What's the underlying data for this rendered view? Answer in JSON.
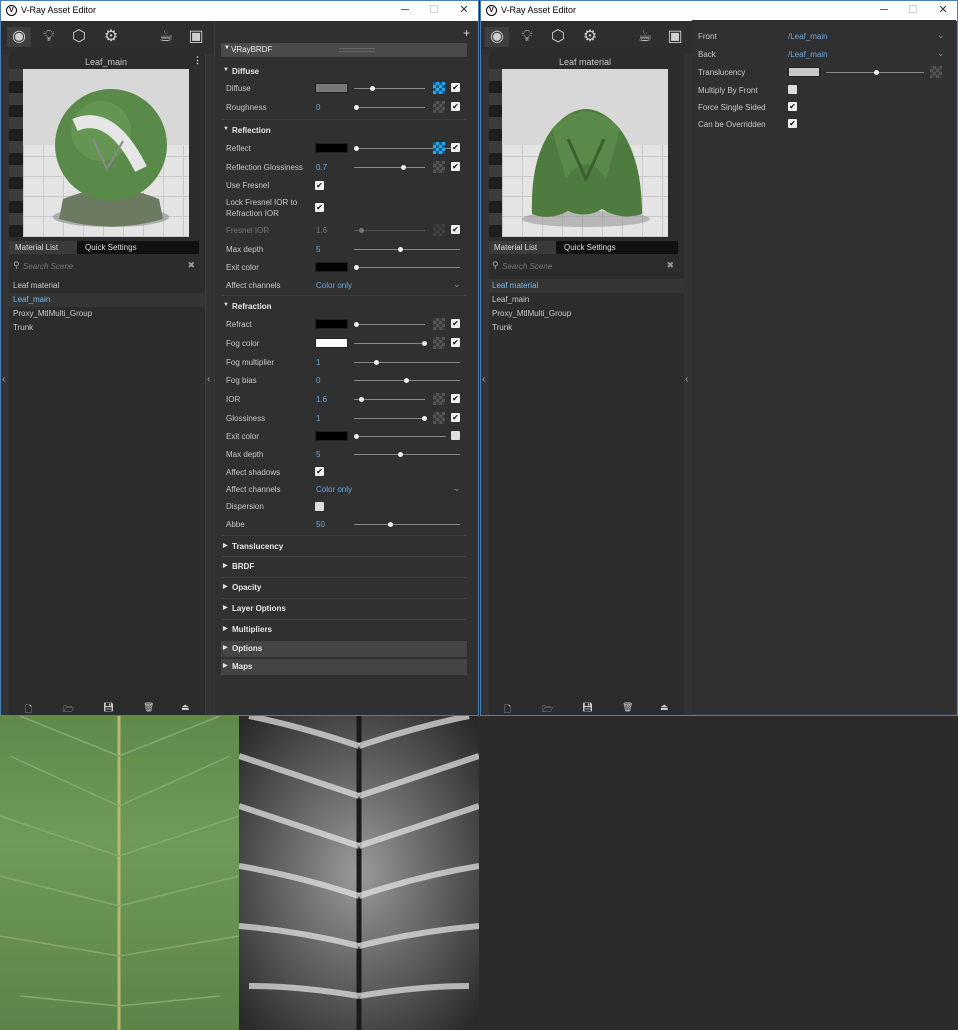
{
  "windowA": {
    "title": "V-Ray Asset Editor",
    "preview_title": "Leaf_main",
    "tabs": [
      "Material List",
      "Quick Settings"
    ],
    "search_placeholder": "Search Scene",
    "materials": [
      "Leaf material",
      "Leaf_main",
      "Proxy_MtlMulti_Group",
      "Trunk"
    ],
    "selected_material": "Leaf_main"
  },
  "windowB": {
    "title": "V-Ray Asset Editor",
    "preview_title": "Leaf material",
    "tabs": [
      "Material List",
      "Quick Settings"
    ],
    "search_placeholder": "Search Scene",
    "materials": [
      "Leaf material",
      "Leaf_main",
      "Proxy_MtlMulti_Group",
      "Trunk"
    ],
    "selected_material": "Leaf material"
  },
  "brdf": {
    "title": "VRayBRDF",
    "diffuse": {
      "header": "Diffuse",
      "diffuse_label": "Diffuse",
      "roughness_label": "Roughness",
      "roughness_value": "0"
    },
    "reflection": {
      "header": "Reflection",
      "reflect_label": "Reflect",
      "gloss_label": "Reflection Glossiness",
      "gloss_value": "0.7",
      "fresnel_label": "Use Fresnel",
      "lock_label_1": "Lock Fresnel IOR to",
      "lock_label_2": "Refraction IOR",
      "fresnel_ior_label": "Fresnel IOR",
      "fresnel_ior_value": "1.6",
      "maxdepth_label": "Max depth",
      "maxdepth_value": "5",
      "exit_label": "Exit color",
      "affect_label": "Affect channels",
      "affect_value": "Color only"
    },
    "refraction": {
      "header": "Refraction",
      "refract_label": "Refract",
      "fog_label": "Fog color",
      "fogmult_label": "Fog multiplier",
      "fogmult_value": "1",
      "fogbias_label": "Fog bias",
      "fogbias_value": "0",
      "ior_label": "IOR",
      "ior_value": "1.6",
      "gloss_label": "Glossiness",
      "gloss_value": "1",
      "exit_label": "Exit color",
      "maxdepth_label": "Max depth",
      "maxdepth_value": "5",
      "shadows_label": "Affect shadows",
      "affect_label": "Affect channels",
      "affect_value": "Color only",
      "dispersion_label": "Dispersion",
      "abbe_label": "Abbe",
      "abbe_value": "50"
    },
    "collapsed_sections": [
      "Translucency",
      "BRDF",
      "Opacity",
      "Layer Options",
      "Multipliers",
      "Options",
      "Maps"
    ]
  },
  "twosided": {
    "front_label": "Front",
    "front_value": "/Leaf_main",
    "back_label": "Back",
    "back_value": "/Leaf_main",
    "translucency_label": "Translucency",
    "multiply_label": "Multiply By Front",
    "force_label": "Force Single Sided",
    "override_label": "Can be Overridden"
  },
  "colors": {
    "accent": "#4fa3e0",
    "panel": "#303030",
    "window_border": "#4a7fb0"
  }
}
